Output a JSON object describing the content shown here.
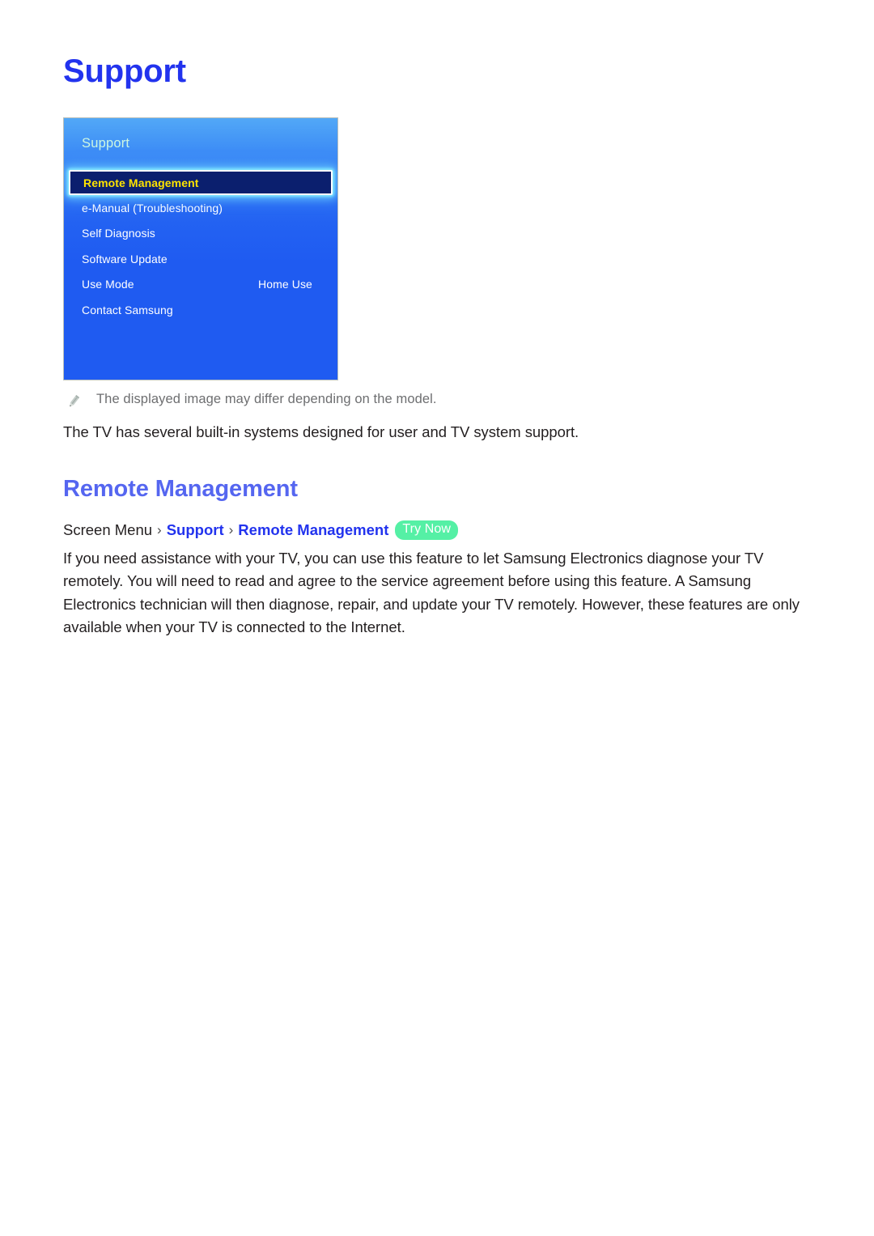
{
  "page": {
    "title": "Support"
  },
  "tv_panel": {
    "header": "Support",
    "items": [
      {
        "label": "Remote Management",
        "value": "",
        "selected": true
      },
      {
        "label": "e-Manual (Troubleshooting)",
        "value": "",
        "selected": false
      },
      {
        "label": "Self Diagnosis",
        "value": "",
        "selected": false
      },
      {
        "label": "Software Update",
        "value": "",
        "selected": false
      },
      {
        "label": "Use Mode",
        "value": "Home Use",
        "selected": false
      },
      {
        "label": "Contact Samsung",
        "value": "",
        "selected": false
      }
    ],
    "colors": {
      "panel_top": "#52a8f7",
      "panel_bottom": "#1f5bf1",
      "selected_bg": "#0b1f6e",
      "selected_text": "#ffe400",
      "glow": "#82ebff",
      "header_text": "#ccf7e2"
    }
  },
  "note": {
    "icon": "pencil-icon",
    "text": "The displayed image may differ depending on the model."
  },
  "intro": {
    "text": "The TV has several built-in systems designed for user and TV system support."
  },
  "section": {
    "title": "Remote Management",
    "title_color": "#5566f0"
  },
  "breadcrumb": {
    "root": "Screen Menu",
    "separator": "›",
    "crumb_1": "Support",
    "crumb_2": "Remote Management",
    "badge": "Try Now",
    "badge_color": "#55f0a5",
    "link_color": "#2233ee"
  },
  "body": {
    "paragraph": "If you need assistance with your TV, you can use this feature to let Samsung Electronics diagnose your TV remotely. You will need to read and agree to the service agreement before using this feature. A Samsung Electronics technician will then diagnose, repair, and update your TV remotely. However, these features are only available when your TV is connected to the Internet."
  }
}
